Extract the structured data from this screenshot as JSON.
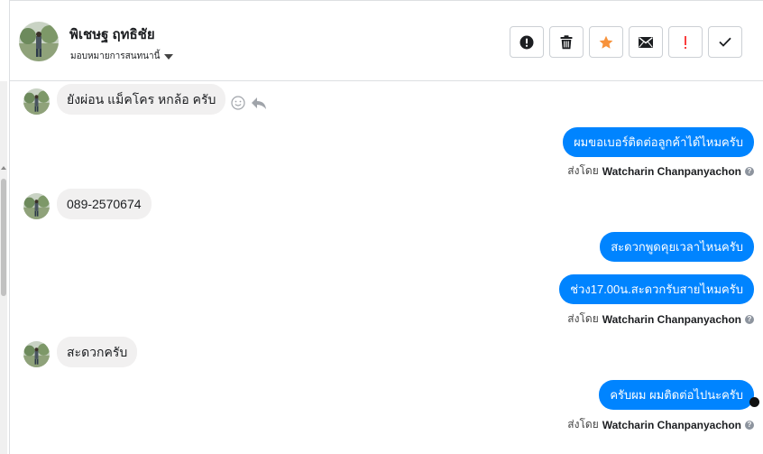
{
  "contact": {
    "name": "พิเชษฐ ฤทธิชัย",
    "assign_label": "มอบหมายการสนทนานี้"
  },
  "actions": [
    {
      "name": "spam-button",
      "icon": "alert-circle-icon"
    },
    {
      "name": "delete-button",
      "icon": "trash-icon"
    },
    {
      "name": "star-button",
      "icon": "star-icon",
      "color": "#f7923b"
    },
    {
      "name": "mark-unread-button",
      "icon": "envelope-icon"
    },
    {
      "name": "follow-up-button",
      "icon": "exclamation-icon",
      "color": "#fa3e3e"
    },
    {
      "name": "done-button",
      "icon": "check-icon"
    }
  ],
  "messages": [
    {
      "direction": "in",
      "text": "ยังผ่อน แม็คโคร หกล้อ ครับ"
    },
    {
      "direction": "out",
      "text": "ผมขอเบอร์ติดต่อลูกค้าได้ไหมครับ"
    },
    {
      "direction": "in",
      "text": "089-2570674"
    },
    {
      "direction": "out",
      "text": "สะดวกพูดคุยเวลาไหนครับ"
    },
    {
      "direction": "out",
      "text": "ช่วง17.00น.สะดวกรับสายไหมครับ"
    },
    {
      "direction": "in",
      "text": "สะดวกครับ"
    },
    {
      "direction": "out",
      "text": "ครับผม ผมติดต่อไปนะครับ"
    }
  ],
  "sent_by": {
    "prefix": "ส่งโดย",
    "name": "Watcharin Chanpanyachon"
  },
  "colors": {
    "outgoing_bubble": "#0084ff",
    "incoming_bubble": "#f1f0f0"
  }
}
